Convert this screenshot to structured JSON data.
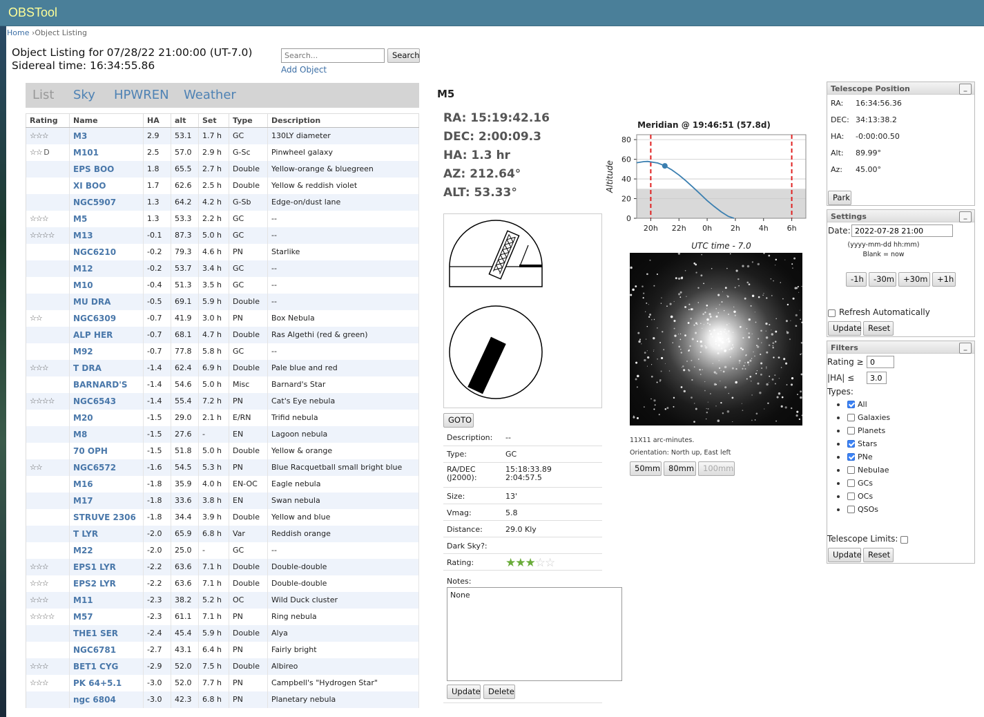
{
  "app": {
    "title": "OBSTool"
  },
  "breadcrumb": {
    "home": "Home",
    "separator": " ›",
    "current": "Object Listing"
  },
  "page": {
    "title_line1": "Object Listing for 07/28/22 21:00:00 (UT-7.0)",
    "title_line2": "Sidereal time: 16:34:55.86"
  },
  "search": {
    "placeholder": "Search...",
    "button": "Search",
    "add_object": "Add Object"
  },
  "tabs": [
    {
      "label": "List",
      "active": true
    },
    {
      "label": "Sky"
    },
    {
      "label": "HPWREN"
    },
    {
      "label": "Weather"
    }
  ],
  "table": {
    "headers": [
      "Rating",
      "Name",
      "HA",
      "alt",
      "Set",
      "Type",
      "Description"
    ],
    "rows": [
      [
        "☆☆☆",
        "M3",
        "2.9",
        "53.1",
        "1.7 h",
        "GC",
        "130LY diameter"
      ],
      [
        "☆☆ D",
        "M101",
        "2.5",
        "57.0",
        "2.9 h",
        "G-Sc",
        "Pinwheel galaxy"
      ],
      [
        "",
        "EPS BOO",
        "1.8",
        "65.5",
        "2.7 h",
        "Double",
        "Yellow-orange & bluegreen"
      ],
      [
        "",
        "XI BOO",
        "1.7",
        "62.6",
        "2.5 h",
        "Double",
        "Yellow & reddish violet"
      ],
      [
        "",
        "NGC5907",
        "1.3",
        "64.2",
        "4.2 h",
        "G-Sb",
        "Edge-on/dust lane"
      ],
      [
        "☆☆☆",
        "M5",
        "1.3",
        "53.3",
        "2.2 h",
        "GC",
        "--"
      ],
      [
        "☆☆☆☆",
        "M13",
        "-0.1",
        "87.3",
        "5.0 h",
        "GC",
        "--"
      ],
      [
        "",
        "NGC6210",
        "-0.2",
        "79.3",
        "4.6 h",
        "PN",
        "Starlike"
      ],
      [
        "",
        "M12",
        "-0.2",
        "53.7",
        "3.4 h",
        "GC",
        "--"
      ],
      [
        "",
        "M10",
        "-0.4",
        "51.3",
        "3.5 h",
        "GC",
        "--"
      ],
      [
        "",
        "MU DRA",
        "-0.5",
        "69.1",
        "5.9 h",
        "Double",
        "--"
      ],
      [
        "☆☆",
        "NGC6309",
        "-0.7",
        "41.9",
        "3.0 h",
        "PN",
        "Box Nebula"
      ],
      [
        "",
        "ALP HER",
        "-0.7",
        "68.1",
        "4.7 h",
        "Double",
        "Ras Algethi (red & green)"
      ],
      [
        "",
        "M92",
        "-0.7",
        "77.8",
        "5.8 h",
        "GC",
        "--"
      ],
      [
        "☆☆☆",
        "T DRA",
        "-1.4",
        "62.4",
        "6.9 h",
        "Double",
        "Pale blue and red"
      ],
      [
        "",
        "BARNARD'S",
        "-1.4",
        "54.6",
        "5.0 h",
        "Misc",
        "Barnard's Star"
      ],
      [
        "☆☆☆☆",
        "NGC6543",
        "-1.4",
        "55.4",
        "7.2 h",
        "PN",
        "Cat's Eye nebula"
      ],
      [
        "",
        "M20",
        "-1.5",
        "29.0",
        "2.1 h",
        "E/RN",
        "Trifid nebula"
      ],
      [
        "",
        "M8",
        "-1.5",
        "27.6",
        "-",
        "EN",
        "Lagoon nebula"
      ],
      [
        "",
        "70 OPH",
        "-1.5",
        "51.8",
        "5.0 h",
        "Double",
        "Yellow & orange"
      ],
      [
        "☆☆",
        "NGC6572",
        "-1.6",
        "54.5",
        "5.3 h",
        "PN",
        "Blue Racquetball small bright blue"
      ],
      [
        "",
        "M16",
        "-1.8",
        "35.9",
        "4.0 h",
        "EN-OC",
        "Eagle nebula"
      ],
      [
        "",
        "M17",
        "-1.8",
        "33.6",
        "3.8 h",
        "EN",
        "Swan nebula"
      ],
      [
        "",
        "STRUVE 2306",
        "-1.8",
        "34.4",
        "3.9 h",
        "Double",
        "Yellow and blue"
      ],
      [
        "",
        "T LYR",
        "-2.0",
        "65.9",
        "6.8 h",
        "Var",
        "Reddish orange"
      ],
      [
        "",
        "M22",
        "-2.0",
        "25.0",
        "-",
        "GC",
        "--"
      ],
      [
        "☆☆☆",
        "EPS1 LYR",
        "-2.2",
        "63.6",
        "7.1 h",
        "Double",
        "Double-double"
      ],
      [
        "☆☆☆",
        "EPS2 LYR",
        "-2.2",
        "63.6",
        "7.1 h",
        "Double",
        "Double-double"
      ],
      [
        "☆☆☆",
        "M11",
        "-2.3",
        "38.2",
        "5.2 h",
        "OC",
        "Wild Duck cluster"
      ],
      [
        "☆☆☆☆",
        "M57",
        "-2.3",
        "61.1",
        "7.1 h",
        "PN",
        "Ring nebula"
      ],
      [
        "",
        "THE1 SER",
        "-2.4",
        "45.4",
        "5.9 h",
        "Double",
        "Alya"
      ],
      [
        "",
        "NGC6781",
        "-2.7",
        "43.1",
        "6.4 h",
        "PN",
        "Fairly bright"
      ],
      [
        "☆☆☆",
        "BET1 CYG",
        "-2.9",
        "52.0",
        "7.5 h",
        "Double",
        "Albireo"
      ],
      [
        "☆☆☆",
        "PK 64+5.1",
        "-3.0",
        "52.0",
        "7.7 h",
        "PN",
        "Campbell's \"Hydrogen Star\""
      ],
      [
        "",
        "ngc 6804",
        "-3.0",
        "42.3",
        "6.8 h",
        "PN",
        "Planetary nebula"
      ]
    ]
  },
  "object": {
    "name": "M5",
    "ra": "RA: 15:19:42.16",
    "dec": "DEC: 2:00:09.3",
    "ha": "HA: 1.3 hr",
    "az": "AZ: 212.64°",
    "alt": "ALT: 53.33°",
    "goto": "GOTO",
    "details": {
      "description_label": "Description:",
      "description": "--",
      "type_label": "Type:",
      "type": "GC",
      "radec_label1": "RA/DEC",
      "radec_label2": "(J2000):",
      "ra_j2000": "15:18:33.89",
      "dec_j2000": "2:04:57.5",
      "size_label": "Size:",
      "size": "13'",
      "vmag_label": "Vmag:",
      "vmag": "5.8",
      "distance_label": "Distance:",
      "distance": "29.0 Kly",
      "darksky_label": "Dark Sky?:",
      "rating_label": "Rating:",
      "rating_value": 3,
      "rating_max": 5,
      "notes_label": "Notes:",
      "notes": "None",
      "update": "Update",
      "delete": "Delete"
    }
  },
  "chart_data": {
    "type": "line",
    "title": "Meridian @ 19:46:51 (57.8d)",
    "xlabel": "UTC time - 7.0",
    "ylabel": "Altitude",
    "x_tick_labels": [
      "20h",
      "22h",
      "0h",
      "2h",
      "4h",
      "6h"
    ],
    "x_ticks_hours": [
      20,
      22,
      24,
      26,
      28,
      30
    ],
    "xlim": [
      19.0,
      31.0
    ],
    "ylim": [
      0,
      85
    ],
    "y_ticks": [
      0,
      20,
      40,
      60,
      80
    ],
    "series": [
      {
        "x": [
          19.0,
          19.5,
          19.78,
          20.5,
          21.0,
          21.5,
          22.0,
          22.5,
          23.0,
          23.5,
          24.0,
          24.5,
          25.0,
          25.5,
          25.9
        ],
        "y": [
          56.5,
          57.6,
          57.8,
          56.2,
          53.3,
          49.2,
          44.0,
          38.0,
          31.5,
          24.8,
          18.0,
          12.0,
          6.5,
          2.0,
          0.0
        ]
      }
    ],
    "current_point": {
      "x": 21.0,
      "y": 53.3
    },
    "limit_lines_hours": [
      20.0,
      30.0
    ],
    "shaded_below": 30,
    "colors": {
      "line": "#3b7fb0",
      "limit": "#e02020",
      "shade": "#d9d9d9"
    }
  },
  "image": {
    "caption1": "11X11 arc-minutes.",
    "caption2": "Orientation: North up, East left",
    "buttons": [
      "50mm",
      "80mm",
      "100mm"
    ]
  },
  "telescope": {
    "title": "Telescope Position",
    "minimize": "_",
    "ra_label": "RA:",
    "ra": "16:34:56.36",
    "dec_label": "DEC:",
    "dec": "34:13:38.2",
    "ha_label": "HA:",
    "ha": "-0:00:00.50",
    "alt_label": "Alt:",
    "alt": "89.99°",
    "az_label": "Az:",
    "az": "45.00°",
    "park": "Park"
  },
  "settings": {
    "title": "Settings",
    "minimize": "_",
    "date_label": "Date:",
    "date_value": "2022-07-28 21:00",
    "hint1": "(yyyy-mm-dd hh:mm)",
    "hint2": "Blank = now",
    "steps": [
      "-1h",
      "-30m",
      "+30m",
      "+1h"
    ],
    "refresh_label": "Refresh Automatically",
    "update": "Update",
    "reset": "Reset"
  },
  "filters": {
    "title": "Filters",
    "minimize": "_",
    "rating_label": "Rating ≥",
    "rating_value": "0",
    "ha_label": "|HA| ≤",
    "ha_value": "3.0",
    "types_label": "Types:",
    "types": [
      {
        "label": "All",
        "checked": true
      },
      {
        "label": "Galaxies",
        "checked": false
      },
      {
        "label": "Planets",
        "checked": false
      },
      {
        "label": "Stars",
        "checked": true
      },
      {
        "label": "PNe",
        "checked": true
      },
      {
        "label": "Nebulae",
        "checked": false
      },
      {
        "label": "GCs",
        "checked": false
      },
      {
        "label": "OCs",
        "checked": false
      },
      {
        "label": "QSOs",
        "checked": false
      }
    ],
    "limits_label": "Telescope Limits:",
    "update": "Update",
    "reset": "Reset"
  }
}
